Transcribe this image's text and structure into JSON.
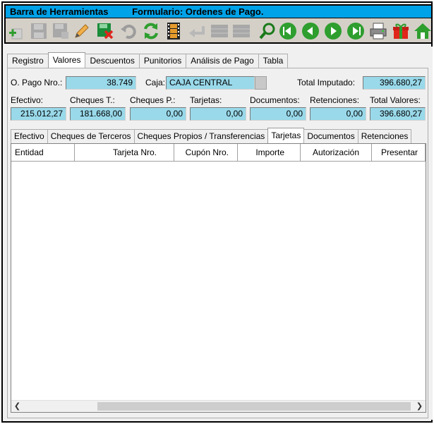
{
  "window": {
    "toolbar_title": "Barra de Herramientas",
    "form_title": "Formulario: Ordenes de Pago."
  },
  "toolbar": {
    "buttons": [
      {
        "name": "add-icon"
      },
      {
        "name": "save-disabled-icon"
      },
      {
        "name": "save-as-disabled-icon"
      },
      {
        "name": "edit-icon"
      },
      {
        "name": "delete-icon"
      },
      {
        "name": "undo-disabled-icon"
      },
      {
        "name": "refresh-icon"
      },
      {
        "name": "film-icon"
      },
      {
        "name": "return-disabled-icon"
      },
      {
        "name": "grid-disabled-icon"
      },
      {
        "name": "grid2-disabled-icon"
      },
      {
        "name": "search-icon"
      },
      {
        "name": "first-record-icon"
      },
      {
        "name": "previous-record-icon"
      },
      {
        "name": "next-record-icon"
      },
      {
        "name": "last-record-icon"
      },
      {
        "name": "print-icon"
      },
      {
        "name": "gift-icon"
      },
      {
        "name": "home-icon"
      }
    ]
  },
  "tabs": [
    "Registro",
    "Valores",
    "Descuentos",
    "Punitorios",
    "Análisis de Pago",
    "Tabla"
  ],
  "active_tab": "Valores",
  "form": {
    "opago_label": "O. Pago Nro.:",
    "opago_value": "38.749",
    "caja_label": "Caja:",
    "caja_value": "CAJA CENTRAL",
    "total_imputado_label": "Total Imputado:",
    "total_imputado_value": "396.680,27",
    "efectivo_label": "Efectivo:",
    "efectivo_value": "215.012,27",
    "cheques_t_label": "Cheques T.:",
    "cheques_t_value": "181.668,00",
    "cheques_p_label": "Cheques P.:",
    "cheques_p_value": "0,00",
    "tarjetas_label": "Tarjetas:",
    "tarjetas_value": "0,00",
    "documentos_label": "Documentos:",
    "documentos_value": "0,00",
    "retenciones_label": "Retenciones:",
    "retenciones_value": "0,00",
    "total_valores_label": "Total Valores:",
    "total_valores_value": "396.680,27"
  },
  "subtabs": [
    "Efectivo",
    "Cheques de Terceros",
    "Cheques Propios / Transferencias",
    "Tarjetas",
    "Documentos",
    "Retenciones"
  ],
  "active_subtab": "Tarjetas",
  "grid": {
    "columns": [
      "Entidad",
      "Tarjeta Nro.",
      "Cupón Nro.",
      "Importe",
      "Autorización",
      "Presentar"
    ],
    "rows": []
  },
  "colors": {
    "title_bar": "#00a2e8",
    "field_bg": "#99d9ea",
    "toolbar_bg": "#d4d0c8"
  }
}
